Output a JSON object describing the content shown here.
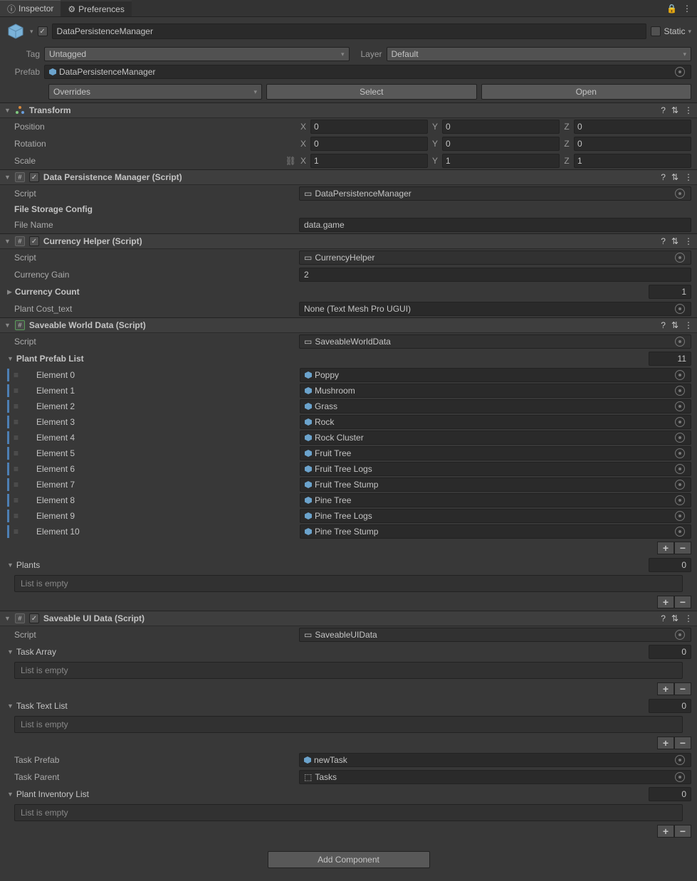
{
  "tabs": {
    "inspector": "Inspector",
    "prefs": "Preferences"
  },
  "header": {
    "name": "DataPersistenceManager",
    "static": "Static",
    "tag_lbl": "Tag",
    "tag_val": "Untagged",
    "layer_lbl": "Layer",
    "layer_val": "Default",
    "prefab_lbl": "Prefab",
    "prefab_val": "DataPersistenceManager",
    "overrides": "Overrides",
    "select": "Select",
    "open": "Open"
  },
  "transform": {
    "title": "Transform",
    "pos": "Position",
    "rot": "Rotation",
    "scale": "Scale",
    "px": "0",
    "py": "0",
    "pz": "0",
    "rx": "0",
    "ry": "0",
    "rz": "0",
    "sx": "1",
    "sy": "1",
    "sz": "1"
  },
  "dpm": {
    "title": "Data Persistence Manager (Script)",
    "script_lbl": "Script",
    "script": "DataPersistenceManager",
    "cfg": "File Storage Config",
    "fname_lbl": "File Name",
    "fname": "data.game"
  },
  "ch": {
    "title": "Currency Helper (Script)",
    "script_lbl": "Script",
    "script": "CurrencyHelper",
    "gain_lbl": "Currency Gain",
    "gain": "2",
    "count_lbl": "Currency Count",
    "count": "1",
    "cost_lbl": "Plant Cost_text",
    "cost": "None (Text Mesh Pro UGUI)"
  },
  "swd": {
    "title": "Saveable World Data (Script)",
    "script_lbl": "Script",
    "script": "SaveableWorldData",
    "list_lbl": "Plant Prefab List",
    "list_size": "11",
    "elems": [
      {
        "l": "Element 0",
        "v": "Poppy"
      },
      {
        "l": "Element 1",
        "v": "Mushroom"
      },
      {
        "l": "Element 2",
        "v": "Grass"
      },
      {
        "l": "Element 3",
        "v": "Rock"
      },
      {
        "l": "Element 4",
        "v": "Rock Cluster"
      },
      {
        "l": "Element 5",
        "v": "Fruit Tree"
      },
      {
        "l": "Element 6",
        "v": "Fruit Tree Logs"
      },
      {
        "l": "Element 7",
        "v": "Fruit Tree Stump"
      },
      {
        "l": "Element 8",
        "v": "Pine Tree"
      },
      {
        "l": "Element 9",
        "v": "Pine Tree Logs"
      },
      {
        "l": "Element 10",
        "v": "Pine Tree Stump"
      }
    ],
    "plants_lbl": "Plants",
    "plants_size": "0",
    "empty": "List is empty"
  },
  "sud": {
    "title": "Saveable UI Data (Script)",
    "script_lbl": "Script",
    "script": "SaveableUIData",
    "ta_lbl": "Task Array",
    "ta_size": "0",
    "ttl_lbl": "Task Text List",
    "ttl_size": "0",
    "tp_lbl": "Task Prefab",
    "tp": "newTask",
    "tparent_lbl": "Task Parent",
    "tparent": "Tasks",
    "pil_lbl": "Plant Inventory List",
    "pil_size": "0",
    "empty": "List is empty"
  },
  "add": "Add Component"
}
